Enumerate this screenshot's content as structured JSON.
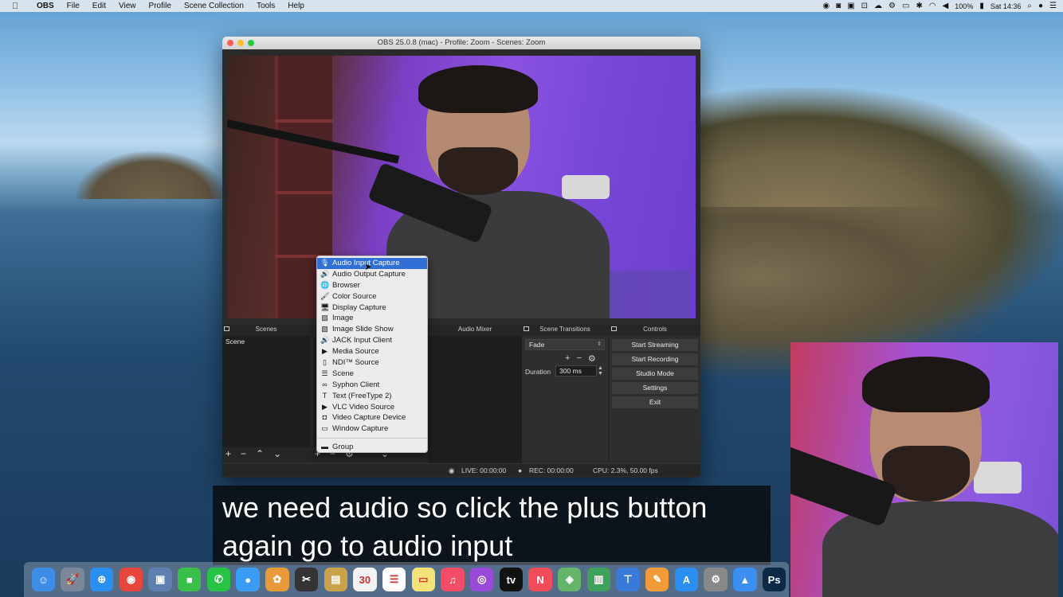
{
  "menubar": {
    "items": [
      "OBS",
      "File",
      "Edit",
      "View",
      "Profile",
      "Scene Collection",
      "Tools",
      "Help"
    ],
    "battery": "100%",
    "clock": "Sat 14:36"
  },
  "window": {
    "title": "OBS 25.0.8 (mac) - Profile: Zoom - Scenes: Zoom"
  },
  "docks": {
    "scenes_header": "Scenes",
    "mixer_header": "Audio Mixer",
    "transitions_header": "Scene Transitions",
    "controls_header": "Controls",
    "scenes": [
      "Scene"
    ],
    "transition": "Fade",
    "duration_label": "Duration",
    "duration_value": "300 ms",
    "controls": [
      "Start Streaming",
      "Start Recording",
      "Studio Mode",
      "Settings",
      "Exit"
    ]
  },
  "context_menu": {
    "items": [
      {
        "label": "Audio Input Capture",
        "icon": "microphone-icon"
      },
      {
        "label": "Audio Output Capture",
        "icon": "speaker-icon"
      },
      {
        "label": "Browser",
        "icon": "globe-icon"
      },
      {
        "label": "Color Source",
        "icon": "brush-icon"
      },
      {
        "label": "Display Capture",
        "icon": "monitor-icon"
      },
      {
        "label": "Image",
        "icon": "image-icon"
      },
      {
        "label": "Image Slide Show",
        "icon": "slideshow-icon"
      },
      {
        "label": "JACK Input Client",
        "icon": "speaker-icon"
      },
      {
        "label": "Media Source",
        "icon": "play-icon"
      },
      {
        "label": "NDI™ Source",
        "icon": "file-icon"
      },
      {
        "label": "Scene",
        "icon": "list-icon"
      },
      {
        "label": "Syphon Client",
        "icon": "glasses-icon"
      },
      {
        "label": "Text (FreeType 2)",
        "icon": "text-icon"
      },
      {
        "label": "VLC Video Source",
        "icon": "play-icon"
      },
      {
        "label": "Video Capture Device",
        "icon": "camera-icon"
      },
      {
        "label": "Window Capture",
        "icon": "window-icon"
      }
    ],
    "group": {
      "label": "Group",
      "icon": "folder-icon"
    },
    "selected_index": 0
  },
  "status": {
    "live": "LIVE: 00:00:00",
    "rec": "REC: 00:00:00",
    "cpu": "CPU: 2.3%, 50.00 fps"
  },
  "caption": {
    "line1": "we need audio so click the plus button",
    "line2": "again go to audio input"
  },
  "dock_apps": [
    {
      "name": "finder-icon",
      "color": "#3d8ce6",
      "glyph": "☺"
    },
    {
      "name": "launchpad-icon",
      "color": "#7b8796",
      "glyph": "🚀"
    },
    {
      "name": "safari-icon",
      "color": "#2a8ff0",
      "glyph": "⊕"
    },
    {
      "name": "chrome-icon",
      "color": "#e8453c",
      "glyph": "◉"
    },
    {
      "name": "preview-icon",
      "color": "#5e7fb0",
      "glyph": "▣"
    },
    {
      "name": "facetime-icon",
      "color": "#39c04a",
      "glyph": "■"
    },
    {
      "name": "whatsapp-icon",
      "color": "#27c346",
      "glyph": "✆"
    },
    {
      "name": "messages-icon",
      "color": "#3b9cf5",
      "glyph": "●"
    },
    {
      "name": "photos-icon",
      "color": "#e89a3a",
      "glyph": "✿"
    },
    {
      "name": "finalcut-icon",
      "color": "#333333",
      "glyph": "✂"
    },
    {
      "name": "notes-icon",
      "color": "#c9a24a",
      "glyph": "▤"
    },
    {
      "name": "calendar-icon",
      "color": "#f2f2f2",
      "glyph": "30"
    },
    {
      "name": "reminders-icon",
      "color": "#ffffff",
      "glyph": "☰"
    },
    {
      "name": "stickies-icon",
      "color": "#f3e27a",
      "glyph": "▭"
    },
    {
      "name": "music-icon",
      "color": "#f34d68",
      "glyph": "♫"
    },
    {
      "name": "podcasts-icon",
      "color": "#9a4ad8",
      "glyph": "◎"
    },
    {
      "name": "appletv-icon",
      "color": "#111111",
      "glyph": "tv"
    },
    {
      "name": "news-icon",
      "color": "#f24c5a",
      "glyph": "N"
    },
    {
      "name": "maps-icon",
      "color": "#64b46a",
      "glyph": "◈"
    },
    {
      "name": "numbers-icon",
      "color": "#3ea35a",
      "glyph": "▥"
    },
    {
      "name": "keynote-icon",
      "color": "#3a7ad6",
      "glyph": "⊤"
    },
    {
      "name": "pages-icon",
      "color": "#f09a3a",
      "glyph": "✎"
    },
    {
      "name": "appstore-icon",
      "color": "#2a8ff0",
      "glyph": "A"
    },
    {
      "name": "system-preferences-icon",
      "color": "#888888",
      "glyph": "⚙"
    },
    {
      "name": "testflight-icon",
      "color": "#3a8ff0",
      "glyph": "▲"
    },
    {
      "name": "photoshop-icon",
      "color": "#0c2a47",
      "glyph": "Ps"
    }
  ]
}
